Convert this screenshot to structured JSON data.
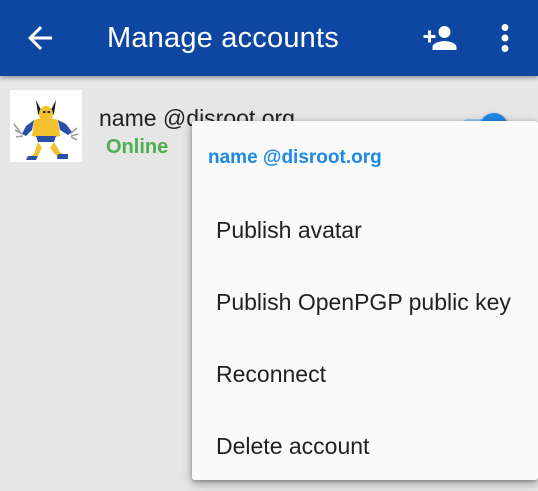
{
  "appbar": {
    "title": "Manage accounts",
    "back_icon": "arrow-back-icon",
    "add_icon": "person-add-icon",
    "menu_icon": "more-vert-icon",
    "background": "#0d47a1"
  },
  "account": {
    "name": "name @disroot.org",
    "status": "Online",
    "status_color": "#4caf50",
    "enabled": true
  },
  "context_menu": {
    "header": "name @disroot.org",
    "items": [
      {
        "label": "Publish avatar"
      },
      {
        "label": "Publish OpenPGP public key"
      },
      {
        "label": "Reconnect"
      },
      {
        "label": "Delete account"
      }
    ]
  },
  "colors": {
    "accent": "#1e88e5",
    "background": "#e6e6e6",
    "menu_background": "#fafafa"
  }
}
